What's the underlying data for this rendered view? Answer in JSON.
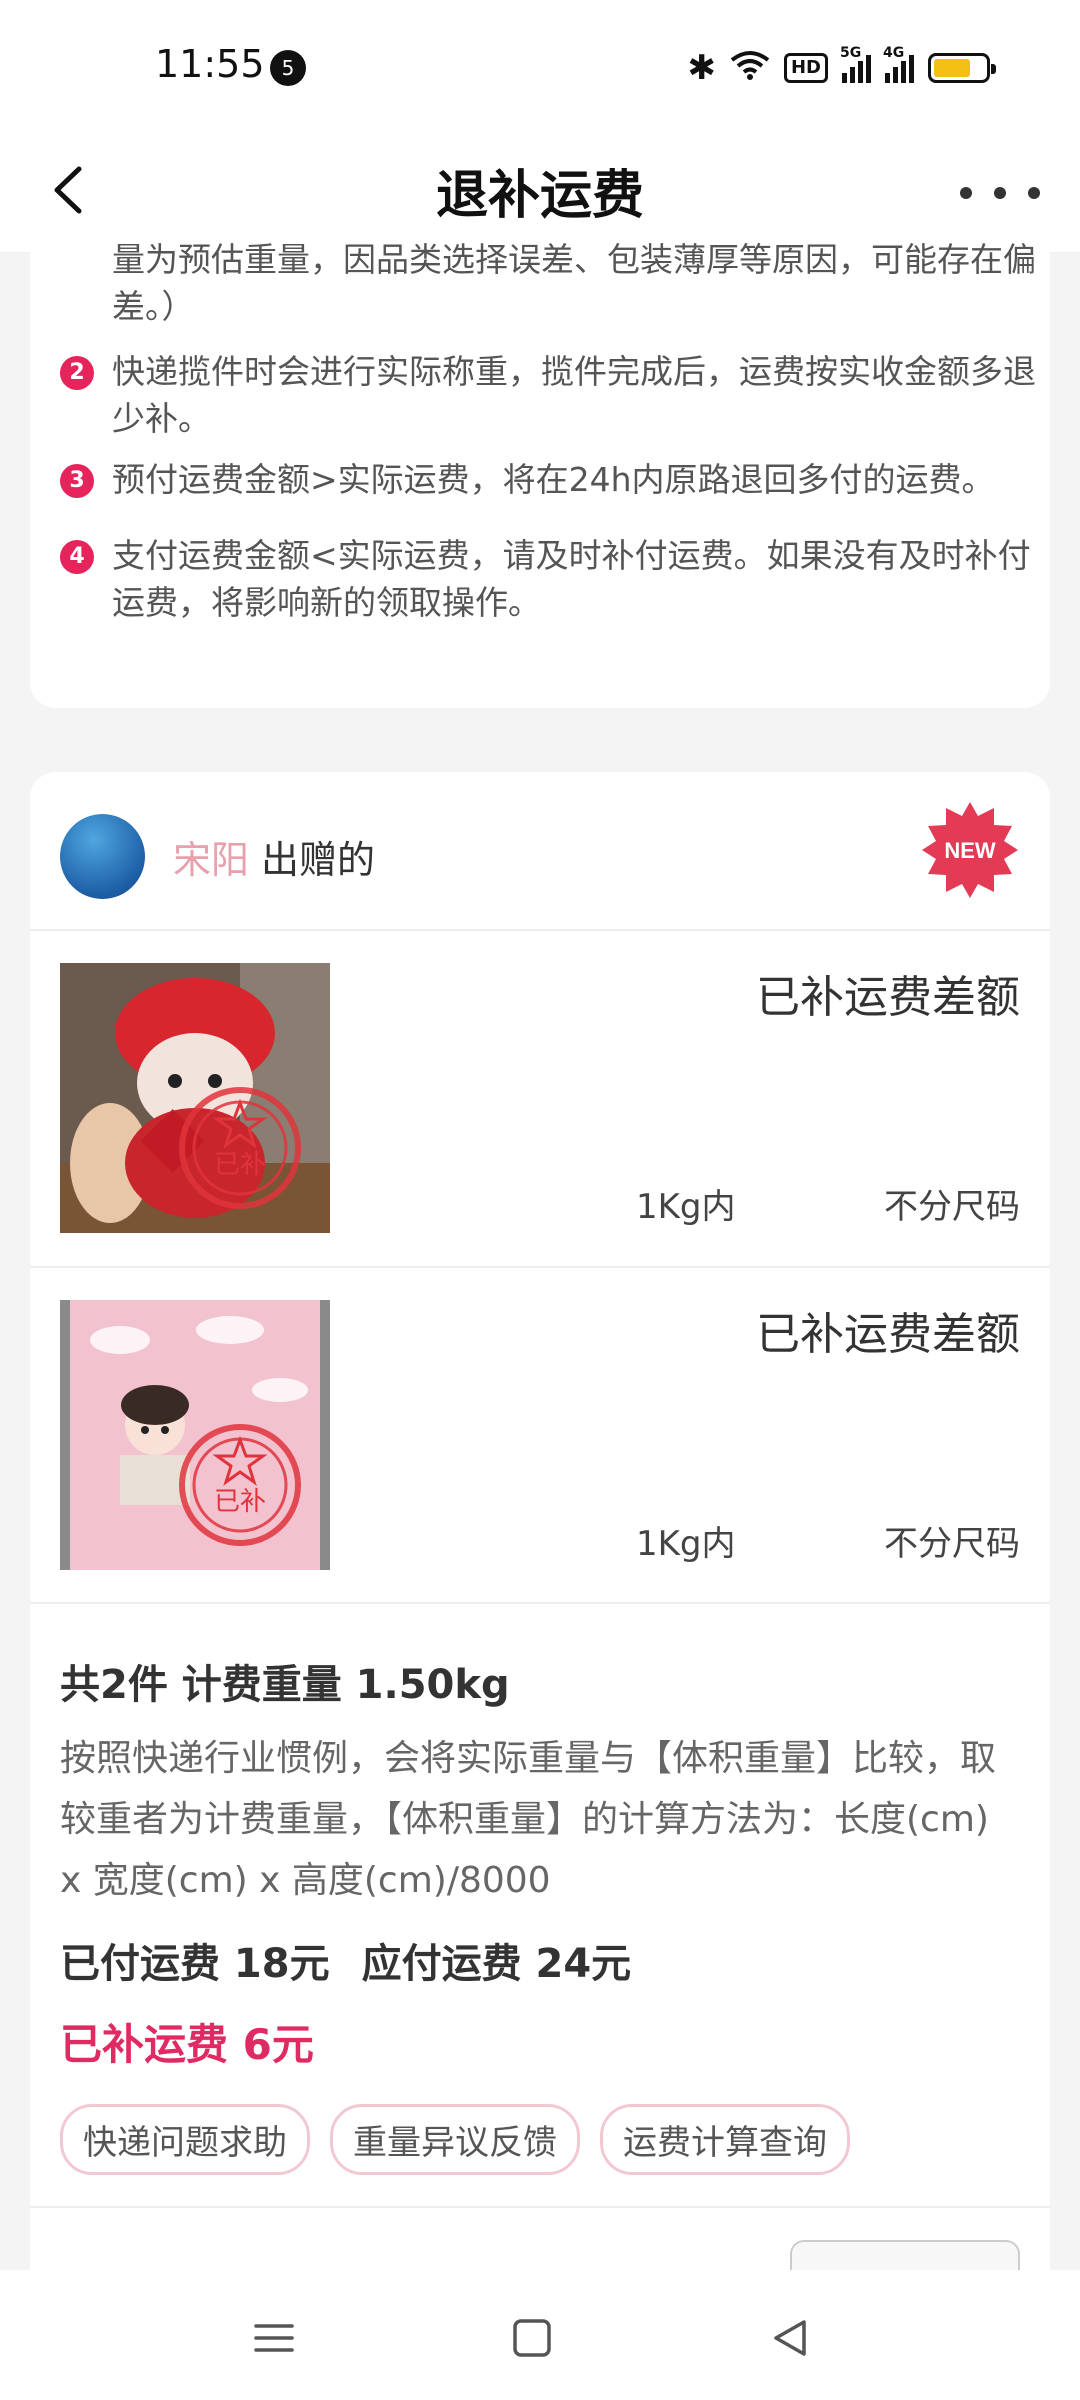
{
  "status_bar": {
    "time": "11:55",
    "notification_count": "5",
    "hd_label": "HD",
    "net1": "5G",
    "net2": "4G",
    "battery_color": "#f5c015"
  },
  "nav": {
    "title": "退补运费"
  },
  "rules": [
    {
      "num": "",
      "text": "量为预估重量，因品类选择误差、包装薄厚等原因，可能存在偏差。）"
    },
    {
      "num": "2",
      "text": "快递揽件时会进行实际称重，揽件完成后，运费按实收金额多退少补。"
    },
    {
      "num": "3",
      "text": "预付运费金额>实际运费，将在24h内原路退回多付的运费。"
    },
    {
      "num": "4",
      "text": "支付运费金额<实际运费，请及时补付运费。如果没有及时补付运费，将影响新的领取操作。"
    }
  ],
  "order": {
    "giver_name": "宋阳",
    "giver_suffix": "出赠的",
    "badge": "NEW",
    "items": [
      {
        "status": "已补运费差额",
        "weight": "1Kg内",
        "size": "不分尺码",
        "stamp": "已补",
        "thumb_icon": "plush-toy-photo"
      },
      {
        "status": "已补运费差额",
        "weight": "1Kg内",
        "size": "不分尺码",
        "stamp": "已补",
        "thumb_icon": "pink-blanket-photo"
      }
    ],
    "summary_head": "共2件 计费重量 1.50kg",
    "summary_desc": "按照快递行业惯例，会将实际重量与【体积重量】比较，取较重者为计费重量，【体积重量】的计算方法为：长度(cm) x 宽度(cm) x 高度(cm)/8000",
    "paid_fee": "已付运费 18元",
    "due_fee": "应付运费 24元",
    "supplement_fee": "已补运费 6元",
    "chips": [
      "快递问题求助",
      "重量异议反馈",
      "运费计算查询"
    ]
  },
  "colors": {
    "accent": "#e02a62",
    "number_badge": "#e5245c",
    "giver_name": "#e8a0ac"
  }
}
